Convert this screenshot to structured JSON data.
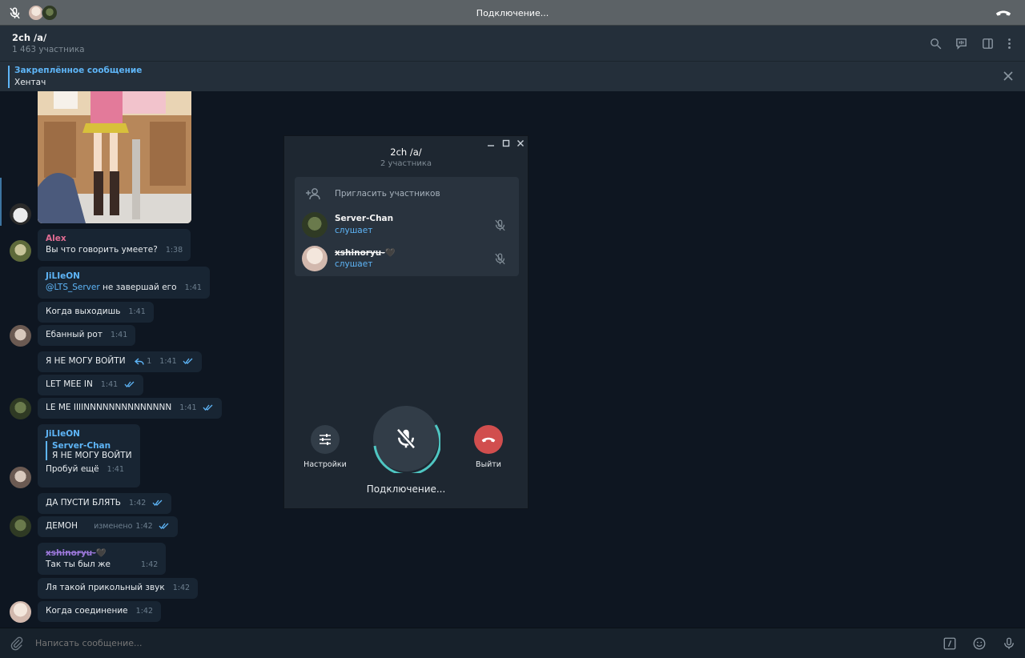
{
  "call_bar": {
    "title": "Подключение...",
    "icons": [
      "mic-off-icon",
      "hang-up-icon"
    ]
  },
  "header": {
    "chat_name": "2ch /a/",
    "members": "1 463 участника",
    "icons": [
      "search-icon",
      "voice-chat-icon",
      "sidebar-toggle-icon",
      "more-icon"
    ]
  },
  "pinned": {
    "label": "Закреплённое сообщение",
    "text": "Хентач"
  },
  "messages": [
    {
      "author": "Alex",
      "author_color": "#e06c92",
      "text": "Вы что говорить умеете?",
      "time": "1:38"
    },
    {
      "author": "JiLIeON",
      "author_color": "#5eb5f7",
      "mention": "@LTS_Server",
      "text": " не завершай его",
      "time": "1:41"
    },
    {
      "text": "Когда выходишь",
      "time": "1:41"
    },
    {
      "text": "Ебанный рот",
      "time": "1:41"
    },
    {
      "text": "Я НЕ МОГУ ВОЙТИ",
      "replies": "1",
      "time": "1:41"
    },
    {
      "text": "LET MEE IN",
      "time": "1:41"
    },
    {
      "text": "LE ME IIIINNNNNNNNNNNNNN",
      "time": "1:41"
    },
    {
      "author": "JiLIeON",
      "author_color": "#5eb5f7",
      "quote_name": "Server-Chan",
      "quote_text": "Я НЕ МОГУ ВОЙТИ",
      "text": "Пробуй ещё",
      "time": "1:41"
    },
    {
      "text": "ДА ПУСТИ БЛЯТЬ",
      "time": "1:42"
    },
    {
      "text": "ДЕМОН",
      "edited": "изменено",
      "time": "1:42"
    },
    {
      "author": "xshinoryu-",
      "author_heart": "🖤",
      "author_color": "#9a77d8",
      "text": "Так ты был же",
      "time": "1:42"
    },
    {
      "text": "Ля такой прикольный звук",
      "time": "1:42"
    },
    {
      "text": "Когда соединение",
      "time": "1:42"
    }
  ],
  "input": {
    "placeholder": "Написать сообщение...",
    "icons": [
      "attach-icon",
      "commands-icon",
      "emoji-icon",
      "microphone-icon"
    ]
  },
  "call_panel": {
    "title": "2ch /a/",
    "subtitle": "2 участника",
    "invite_label": "Пригласить участников",
    "participants": [
      {
        "name": "Server-Chan",
        "status": "слушает"
      },
      {
        "name": "xshinoryu-",
        "heart": "🖤",
        "status": "слушает"
      }
    ],
    "settings_label": "Настройки",
    "leave_label": "Выйти",
    "status": "Подключение..."
  },
  "colors": {
    "accent": "#5eb5f7",
    "hangup": "#d14e4e",
    "bubble": "#182533",
    "chat_bg": "#0e1621"
  }
}
